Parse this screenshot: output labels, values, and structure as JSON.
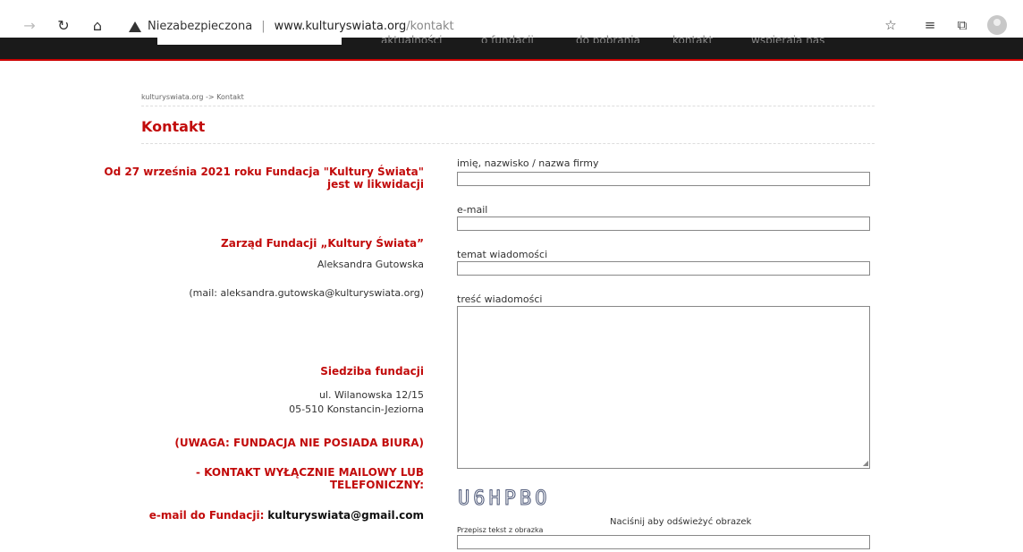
{
  "browser": {
    "security_label": "Niezabezpieczona",
    "url_host": "www.kulturyswiata.org",
    "url_path": "/kontakt"
  },
  "site_menu": [
    "aktualności",
    "o fundacji",
    "do pobrania",
    "kontakt",
    "wspierają nas"
  ],
  "breadcrumb": "kulturyswiata.org -> Kontakt",
  "page_title": "Kontakt",
  "left": {
    "liquidation": "Od 27 września 2021 roku Fundacja \"Kultury Świata\" jest w likwidacji",
    "board_heading": "Zarząd Fundacji „Kultury Świata”",
    "board_name": "Aleksandra Gutowska",
    "board_mail": "(mail: aleksandra.gutowska@kulturyswiata.org)",
    "seat_heading": "Siedziba fundacji",
    "seat_street": "ul. Wilanowska 12/15",
    "seat_city": "05-510 Konstancin-Jeziorna",
    "notice_office": "(UWAGA: FUNDACJA NIE POSIADA BIURA)",
    "notice_contact": "- KONTAKT WYŁĄCZNIE MAILOWY LUB TELEFONICZNY:",
    "email_label": "e-mail do Fundacji:",
    "email_value": "kulturyswiata@gmail.com"
  },
  "form": {
    "name_label": "imię, nazwisko / nazwa firmy",
    "name_value": "",
    "email_label": "e-mail",
    "email_value": "",
    "subject_label": "temat wiadomości",
    "subject_value": "",
    "message_label": "treść wiadomości",
    "message_value": "",
    "captcha_text": "U6HPBO",
    "refresh_hint": "Naciśnij aby odświeżyć obrazek",
    "captcha_label": "Przepisz tekst z obrazka",
    "captcha_value": ""
  },
  "icons": [
    "back-arrow-icon",
    "reload-icon",
    "home-icon",
    "warning-icon",
    "favorite-add-icon",
    "favorites-icon",
    "collections-icon",
    "profile-icon",
    "resize-grip-icon"
  ]
}
